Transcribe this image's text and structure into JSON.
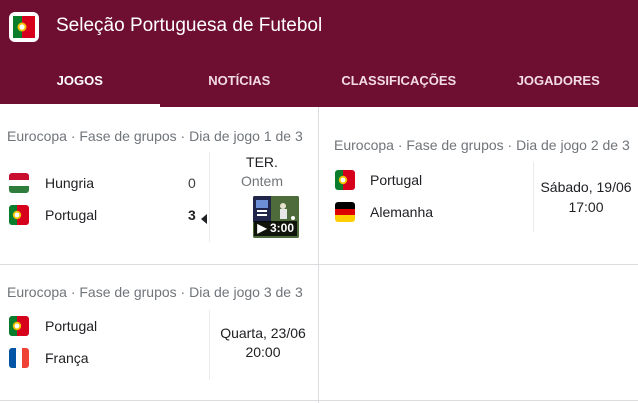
{
  "header": {
    "title": "Seleção Portuguesa de Futebol"
  },
  "tabs": [
    {
      "label": "JOGOS",
      "active": true
    },
    {
      "label": "NOTÍCIAS"
    },
    {
      "label": "CLASSIFICAÇÕES"
    },
    {
      "label": "JOGADORES"
    }
  ],
  "matches": [
    {
      "meta": "Eurocopa · Fase de grupos · Dia de jogo 1 de 3",
      "teams": [
        {
          "name": "Hungria",
          "score": "0",
          "flag": "hungary-flag-icon"
        },
        {
          "name": "Portugal",
          "score": "3",
          "flag": "portugal-flag-icon",
          "winner": true
        }
      ],
      "day": "TER.",
      "date": "Ontem",
      "video_duration": "3:00"
    },
    {
      "meta": "Eurocopa · Fase de grupos · Dia de jogo 2 de 3",
      "teams": [
        {
          "name": "Portugal",
          "flag": "portugal-flag-icon"
        },
        {
          "name": "Alemanha",
          "flag": "germany-flag-icon"
        }
      ],
      "date": "Sábado, 19/06",
      "time": "17:00"
    },
    {
      "meta": "Eurocopa · Fase de grupos · Dia de jogo 3 de 3",
      "teams": [
        {
          "name": "Portugal",
          "flag": "portugal-flag-icon"
        },
        {
          "name": "França",
          "flag": "france-flag-icon"
        }
      ],
      "date": "Quarta, 23/06",
      "time": "20:00"
    }
  ],
  "colors": {
    "header_bg": "#6e0f32",
    "tab_text": "#f3dbe3"
  }
}
